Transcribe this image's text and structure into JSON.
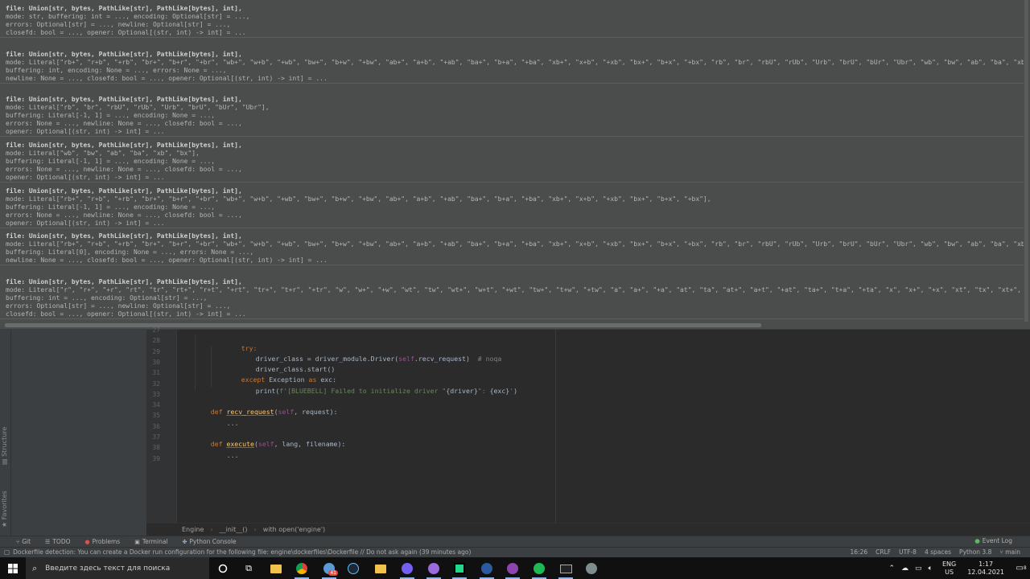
{
  "popup": {
    "signatures": [
      [
        "file: Union[str, bytes, PathLike[str], PathLike[bytes], int],",
        "mode: str, buffering: int = ..., encoding: Optional[str] = ...,",
        "errors: Optional[str] = ..., newline: Optional[str] = ...,",
        "closefd: bool = ..., opener: Optional[(str, int) -> int] = ..."
      ],
      [
        "file: Union[str, bytes, PathLike[str], PathLike[bytes], int],",
        "mode: Literal[\"rb+\", \"r+b\", \"+rb\", \"br+\", \"b+r\", \"+br\", \"wb+\", \"w+b\", \"+wb\", \"bw+\", \"b+w\", \"+bw\", \"ab+\", \"a+b\", \"+ab\", \"ba+\", \"b+a\", \"+ba\", \"xb+\", \"x+b\", \"+xb\", \"bx+\", \"b+x\", \"+bx\", \"rb\", \"br\", \"rbU\", \"rUb\", \"Urb\", \"brU\", \"bUr\", \"Ubr\", \"wb\", \"bw\", \"ab\", \"ba\", \"xb\", \"bx\"],",
        "buffering: int, encoding: None = ..., errors: None = ...,",
        "newline: None = ..., closefd: bool = ..., opener: Optional[(str, int) -> int] = ..."
      ],
      [
        "file: Union[str, bytes, PathLike[str], PathLike[bytes], int],",
        "mode: Literal[\"rb\", \"br\", \"rbU\", \"rUb\", \"Urb\", \"brU\", \"bUr\", \"Ubr\"],",
        "buffering: Literal[-1, 1] = ..., encoding: None = ...,",
        "errors: None = ..., newline: None = ..., closefd: bool = ...,",
        "opener: Optional[(str, int) -> int] = ..."
      ],
      [
        "file: Union[str, bytes, PathLike[str], PathLike[bytes], int],",
        "mode: Literal[\"wb\", \"bw\", \"ab\", \"ba\", \"xb\", \"bx\"],",
        "buffering: Literal[-1, 1] = ..., encoding: None = ...,",
        "errors: None = ..., newline: None = ..., closefd: bool = ...,",
        "opener: Optional[(str, int) -> int] = ..."
      ],
      [
        "file: Union[str, bytes, PathLike[str], PathLike[bytes], int],",
        "mode: Literal[\"rb+\", \"r+b\", \"+rb\", \"br+\", \"b+r\", \"+br\", \"wb+\", \"w+b\", \"+wb\", \"bw+\", \"b+w\", \"+bw\", \"ab+\", \"a+b\", \"+ab\", \"ba+\", \"b+a\", \"+ba\", \"xb+\", \"x+b\", \"+xb\", \"bx+\", \"b+x\", \"+bx\"],",
        "buffering: Literal[-1, 1] = ..., encoding: None = ...,",
        "errors: None = ..., newline: None = ..., closefd: bool = ...,",
        "opener: Optional[(str, int) -> int] = ..."
      ],
      [
        "file: Union[str, bytes, PathLike[str], PathLike[bytes], int],",
        "mode: Literal[\"rb+\", \"r+b\", \"+rb\", \"br+\", \"b+r\", \"+br\", \"wb+\", \"w+b\", \"+wb\", \"bw+\", \"b+w\", \"+bw\", \"ab+\", \"a+b\", \"+ab\", \"ba+\", \"b+a\", \"+ba\", \"xb+\", \"x+b\", \"+xb\", \"bx+\", \"b+x\", \"+bx\", \"rb\", \"br\", \"rbU\", \"rUb\", \"Urb\", \"brU\", \"bUr\", \"Ubr\", \"wb\", \"bw\", \"ab\", \"ba\", \"xb\", \"bx\"],",
        "buffering: Literal[0], encoding: None = ..., errors: None = ...,",
        "newline: None = ..., closefd: bool = ..., opener: Optional[(str, int) -> int] = ..."
      ],
      [
        "file: Union[str, bytes, PathLike[str], PathLike[bytes], int],",
        "mode: Literal[\"r\", \"r+\", \"+r\", \"rt\", \"tr\", \"rt+\", \"r+t\", \"+rt\", \"tr+\", \"t+r\", \"+tr\", \"w\", \"w+\", \"+w\", \"wt\", \"tw\", \"wt+\", \"w+t\", \"+wt\", \"tw+\", \"t+w\", \"+tw\", \"a\", \"a+\", \"+a\", \"at\", \"ta\", \"at+\", \"a+t\", \"+at\", \"ta+\", \"t+a\", \"+ta\", \"x\", \"x+\", \"+x\", \"xt\", \"tx\", \"xt+\", \"x+t\", \"+x",
        "buffering: int = ..., encoding: Optional[str] = ...,",
        "errors: Optional[str] = ..., newline: Optional[str] = ...,",
        "closefd: bool = ..., opener: Optional[(str, int) -> int] = ..."
      ]
    ]
  },
  "left_strip": {
    "structure": "Structure",
    "favorites": "Favorites"
  },
  "editor": {
    "line_numbers": [
      "27",
      "28",
      "29",
      "30",
      "31",
      "32",
      "33",
      "34",
      "35",
      "36",
      "37",
      "38",
      "39"
    ],
    "lines": {
      "l28": {
        "kw": "try:"
      },
      "l29": {
        "pre": "driver_class = driver_module.Driver(",
        "self": "self",
        "post": ".recv_request)  ",
        "cmt": "# noqa"
      },
      "l30": {
        "text": "driver_class.start()"
      },
      "l31": {
        "kw1": "except ",
        "exc": "Exception ",
        "kw2": "as ",
        "post": "exc:"
      },
      "l32": {
        "pre": "print(",
        "str": "f'[BLUEBELL] Failed to initialize driver \"",
        "b1": "{driver}",
        "str2": "\": ",
        "b2": "{exc}",
        "str3": "'",
        "post": ")"
      },
      "l34": {
        "kw": "def ",
        "fn": "recv_request",
        "pre": "(",
        "self": "self",
        "post": ", request):"
      },
      "l35": {
        "text": "..."
      },
      "l37": {
        "kw": "def ",
        "fn": "execute",
        "pre": "(",
        "self": "self",
        "post": ", lang, filename):"
      },
      "l38": {
        "text": "..."
      }
    }
  },
  "breadcrumb": [
    "Engine",
    "__init__()",
    "with open('engine')"
  ],
  "toolwindows": {
    "git": "Git",
    "todo": "TODO",
    "problems": "Problems",
    "terminal": "Terminal",
    "python_console": "Python Console",
    "event_log": "Event Log"
  },
  "status": {
    "message": "Dockerfile detection: You can create a Docker run configuration for the following file: engine\\dockerfiles\\Dockerfile // Do not ask again (39 minutes ago)",
    "position": "16:26",
    "line_sep": "CRLF",
    "encoding": "UTF-8",
    "indent": "4 spaces",
    "interpreter": "Python 3.8",
    "branch": "main"
  },
  "taskbar": {
    "search_placeholder": "Введите здесь текст для поиска",
    "badge": "41",
    "lang_top": "ENG",
    "lang_bottom": "US",
    "time": "1:17",
    "date": "12.04.2021",
    "notif_count": "8"
  },
  "colors": {
    "popup_bg": "#4b4d4d",
    "editor_bg": "#2b2b2b",
    "keyword": "#cc7832",
    "string": "#6a8759",
    "function": "#ffc66d",
    "self": "#94558d",
    "comment": "#808080"
  }
}
